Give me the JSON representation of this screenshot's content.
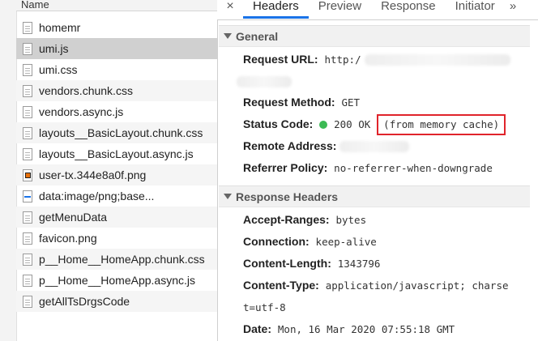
{
  "left_panel": {
    "column_header": "Name",
    "files": [
      {
        "name": "homemr",
        "icon": "document-icon",
        "selected": false
      },
      {
        "name": "umi.js",
        "icon": "document-icon",
        "selected": true
      },
      {
        "name": "umi.css",
        "icon": "document-icon",
        "selected": false
      },
      {
        "name": "vendors.chunk.css",
        "icon": "document-icon",
        "selected": false
      },
      {
        "name": "vendors.async.js",
        "icon": "document-icon",
        "selected": false
      },
      {
        "name": "layouts__BasicLayout.chunk.css",
        "icon": "document-icon",
        "selected": false
      },
      {
        "name": "layouts__BasicLayout.async.js",
        "icon": "document-icon",
        "selected": false
      },
      {
        "name": "user-tx.344e8a0f.png",
        "icon": "image-icon",
        "selected": false
      },
      {
        "name": "data:image/png;base...",
        "icon": "data-image-icon",
        "selected": false
      },
      {
        "name": "getMenuData",
        "icon": "document-icon",
        "selected": false
      },
      {
        "name": "favicon.png",
        "icon": "document-icon",
        "selected": false
      },
      {
        "name": "p__Home__HomeApp.chunk.css",
        "icon": "document-icon",
        "selected": false
      },
      {
        "name": "p__Home__HomeApp.async.js",
        "icon": "document-icon",
        "selected": false
      },
      {
        "name": "getAllTsDrgsCode",
        "icon": "document-icon",
        "selected": false
      }
    ]
  },
  "tabs": {
    "close": "×",
    "items": [
      "Headers",
      "Preview",
      "Response",
      "Initiator"
    ],
    "active": "Headers",
    "more": "»"
  },
  "general": {
    "title": "General",
    "request_url_label": "Request URL:",
    "request_url_value": "http:/",
    "request_method_label": "Request Method:",
    "request_method_value": "GET",
    "status_code_label": "Status Code:",
    "status_code_value": "200 OK",
    "status_cache_note": "(from memory cache)",
    "remote_address_label": "Remote Address:",
    "referrer_policy_label": "Referrer Policy:",
    "referrer_policy_value": "no-referrer-when-downgrade"
  },
  "response_headers": {
    "title": "Response Headers",
    "rows": [
      {
        "key": "Accept-Ranges:",
        "value": "bytes"
      },
      {
        "key": "Connection:",
        "value": "keep-alive"
      },
      {
        "key": "Content-Length:",
        "value": "1343796"
      },
      {
        "key": "Content-Type:",
        "value": "application/javascript; charse"
      },
      {
        "key": "",
        "value": "t=utf-8"
      },
      {
        "key": "Date:",
        "value": "Mon, 16 Mar 2020 07:55:18 GMT"
      }
    ]
  },
  "colors": {
    "accent": "#1a73e8",
    "status_ok": "#3cba54",
    "highlight_box": "#e0242b",
    "selected_row": "#d0d0d0"
  }
}
